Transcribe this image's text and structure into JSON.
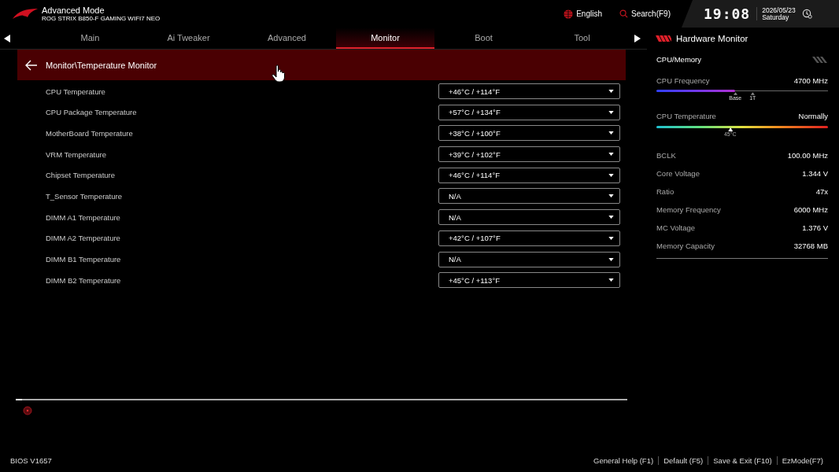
{
  "header": {
    "mode": "Advanced Mode",
    "model": "ROG STRIX B850-F GAMING WIFI7 NEO",
    "language": "English",
    "search": "Search(F9)",
    "time": "19:08",
    "date": "2026/05/23",
    "weekday": "Saturday"
  },
  "tabs": [
    {
      "label": "Main",
      "selected": false
    },
    {
      "label": "Ai Tweaker",
      "selected": false
    },
    {
      "label": "Advanced",
      "selected": false
    },
    {
      "label": "Monitor",
      "selected": true
    },
    {
      "label": "Boot",
      "selected": false
    },
    {
      "label": "Tool",
      "selected": false
    }
  ],
  "breadcrumb": "Monitor\\Temperature Monitor",
  "sensors": [
    {
      "label": "CPU Temperature",
      "value": "+46°C / +114°F"
    },
    {
      "label": "CPU Package Temperature",
      "value": "+57°C / +134°F"
    },
    {
      "label": "MotherBoard Temperature",
      "value": "+38°C / +100°F"
    },
    {
      "label": "VRM Temperature",
      "value": "+39°C / +102°F"
    },
    {
      "label": "Chipset Temperature",
      "value": "+46°C / +114°F"
    },
    {
      "label": "T_Sensor Temperature",
      "value": "N/A"
    },
    {
      "label": "DIMM A1 Temperature",
      "value": "N/A"
    },
    {
      "label": "DIMM A2 Temperature",
      "value": "+42°C / +107°F"
    },
    {
      "label": "DIMM B1 Temperature",
      "value": "N/A"
    },
    {
      "label": "DIMM B2 Temperature",
      "value": "+45°C / +113°F"
    }
  ],
  "hardware_monitor": {
    "title": "Hardware Monitor",
    "section": "CPU/Memory",
    "frequency": {
      "label": "CPU Frequency",
      "reading": "4700 MHz",
      "level": 0.46,
      "markers": [
        "Base",
        "1T"
      ]
    },
    "temperature": {
      "label": "CPU Temperature",
      "reading": "Normally",
      "level": 0.43,
      "marker": "45°C"
    },
    "stats": [
      {
        "label": "BCLK",
        "value": "100.00 MHz"
      },
      {
        "label": "Core Voltage",
        "value": "1.344 V"
      },
      {
        "label": "Ratio",
        "value": "47x"
      },
      {
        "label": "Memory Frequency",
        "value": "6000 MHz"
      },
      {
        "label": "MC Voltage",
        "value": "1.376 V"
      },
      {
        "label": "Memory Capacity",
        "value": "32768 MB"
      }
    ]
  },
  "footer": {
    "version": "BIOS V1657",
    "actions": [
      "General Help (F1)",
      "Default (F5)",
      "Save & Exit (F10)",
      "EzMode(F7)"
    ]
  }
}
